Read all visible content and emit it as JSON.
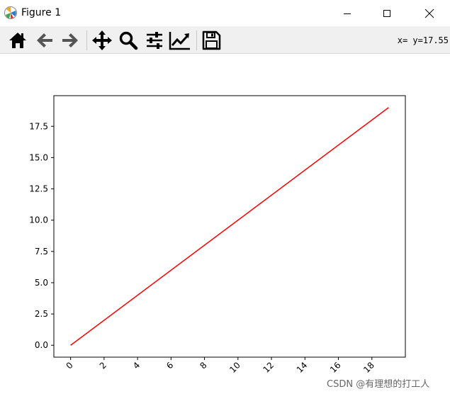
{
  "window": {
    "title": "Figure 1",
    "controls": [
      "minimize-icon",
      "maximize-icon",
      "close-icon"
    ]
  },
  "toolbar": {
    "buttons": [
      "home-icon",
      "back-icon",
      "forward-icon",
      "pan-icon",
      "zoom-icon",
      "subplots-icon",
      "customize-icon",
      "save-icon"
    ],
    "coordinate_readout": "x= y=17.55"
  },
  "colors": {
    "line": "#ff0000",
    "axes": "#000000",
    "toolbar_bg": "#f0f0f0"
  },
  "chart_data": {
    "type": "line",
    "title": "",
    "xlabel": "",
    "ylabel": "",
    "xlim": [
      -1.0,
      20.0
    ],
    "ylim": [
      -0.95,
      19.95
    ],
    "xticks": [
      0,
      2,
      4,
      6,
      8,
      10,
      12,
      14,
      16,
      18
    ],
    "xtick_labels": [
      "0",
      "2",
      "4",
      "6",
      "8",
      "10",
      "12",
      "14",
      "16",
      "18"
    ],
    "xtick_rotation": 45,
    "yticks": [
      0.0,
      2.5,
      5.0,
      7.5,
      10.0,
      12.5,
      15.0,
      17.5
    ],
    "ytick_labels": [
      "0.0",
      "2.5",
      "5.0",
      "7.5",
      "10.0",
      "12.5",
      "15.0",
      "17.5"
    ],
    "grid": false,
    "series": [
      {
        "color": "#ff0000",
        "x": [
          0,
          19
        ],
        "y": [
          0,
          19
        ]
      }
    ]
  },
  "watermark": "CSDN @有理想的打工人"
}
